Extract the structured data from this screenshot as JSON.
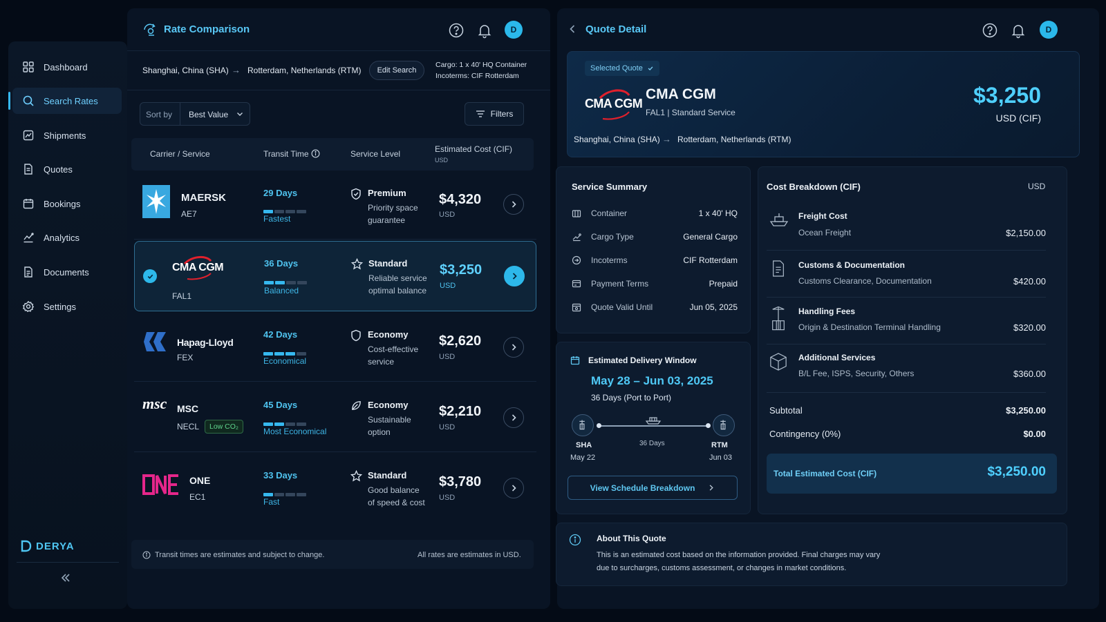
{
  "sidebar": {
    "items": [
      {
        "label": "Dashboard",
        "icon": "grid-icon"
      },
      {
        "label": "Search Rates",
        "icon": "search-icon",
        "active": true
      },
      {
        "label": "Shipments",
        "icon": "shipments-icon"
      },
      {
        "label": "Quotes",
        "icon": "document-icon"
      },
      {
        "label": "Bookings",
        "icon": "calendar-icon"
      },
      {
        "label": "Analytics",
        "icon": "analytics-icon"
      },
      {
        "label": "Documents",
        "icon": "documents-icon"
      },
      {
        "label": "Settings",
        "icon": "gear-icon"
      }
    ],
    "brand": "DERYA"
  },
  "left": {
    "title": "Rate Comparison",
    "avatar": "D",
    "route": {
      "origin": "Shanghai, China (SHA)",
      "destination": "Rotterdam, Netherlands (RTM)",
      "edit_label": "Edit Search",
      "cargo": "Cargo: 1 x 40' HQ Container",
      "incoterms": "Incoterms: CIF Rotterdam"
    },
    "sort": {
      "label": "Sort by",
      "value": "Best Value"
    },
    "filters_label": "Filters",
    "columns": {
      "carrier": "Carrier / Service",
      "transit": "Transit Time",
      "service": "Service Level",
      "cost": "Estimated Cost (CIF)",
      "cost_unit": "USD"
    },
    "rows": [
      {
        "carrier": "MAERSK",
        "code": "AE7",
        "days": "29 Days",
        "tag": "Fastest",
        "level": "Premium",
        "desc1": "Priority space",
        "desc2": "guarantee",
        "price": "$4,320",
        "currency": "USD",
        "speed": 0.25
      },
      {
        "carrier": "CMA CGM",
        "code": "FAL1",
        "days": "36 Days",
        "tag": "Balanced",
        "level": "Standard",
        "desc1": "Reliable service",
        "desc2": "optimal balance",
        "price": "$3,250",
        "currency": "USD",
        "speed": 0.5
      },
      {
        "carrier": "Hapag-Lloyd",
        "code": "FEX",
        "days": "42 Days",
        "tag": "Economical",
        "level": "Economy",
        "desc1": "Cost-effective",
        "desc2": "service",
        "price": "$2,620",
        "currency": "USD",
        "speed": 0.75
      },
      {
        "carrier": "MSC",
        "code": "NECL",
        "badge": "Low CO₂",
        "days": "45 Days",
        "tag": "Most Economical",
        "level": "Economy",
        "desc1": "Sustainable",
        "desc2": "option",
        "price": "$2,210",
        "currency": "USD",
        "speed": 0.5
      },
      {
        "carrier": "ONE",
        "code": "EC1",
        "days": "33 Days",
        "tag": "Fast",
        "level": "Standard",
        "desc1": "Good balance",
        "desc2": "of speed & cost",
        "price": "$3,780",
        "currency": "USD",
        "speed": 0.25
      }
    ],
    "footer_left": "Transit times are estimates and subject to change.",
    "footer_right": "All rates are estimates in USD."
  },
  "right": {
    "title": "Quote Detail",
    "avatar": "D",
    "selected_label": "Selected Quote",
    "carrier": "CMA CGM",
    "logo_text": "CMA CGM",
    "service": "FAL1 | Standard Service",
    "price": "$3,250",
    "price_unit": "USD (CIF)",
    "origin": "Shanghai, China (SHA)",
    "destination": "Rotterdam, Netherlands (RTM)",
    "summary": {
      "title": "Service Summary",
      "items": [
        {
          "label": "Container",
          "value": "1 x 40' HQ"
        },
        {
          "label": "Cargo Type",
          "value": "General Cargo"
        },
        {
          "label": "Incoterms",
          "value": "CIF Rotterdam"
        },
        {
          "label": "Payment Terms",
          "value": "Prepaid"
        },
        {
          "label": "Quote Valid Until",
          "value": "Jun 05, 2025"
        }
      ]
    },
    "delivery": {
      "title": "Estimated Delivery Window",
      "range": "May 28 – Jun 03, 2025",
      "duration": "36 Days (Port to Port)",
      "from_code": "SHA",
      "from_date": "May 22",
      "to_code": "RTM",
      "to_date": "Jun 03",
      "mid": "36 Days",
      "button": "View Schedule Breakdown"
    },
    "breakdown": {
      "title": "Cost Breakdown (CIF)",
      "unit": "USD",
      "items": [
        {
          "title": "Freight Cost",
          "sub": "Ocean Freight",
          "amount": "$2,150.00"
        },
        {
          "title": "Customs & Documentation",
          "sub": "Customs Clearance, Documentation",
          "amount": "$420.00"
        },
        {
          "title": "Handling Fees",
          "sub": "Origin & Destination Terminal Handling",
          "amount": "$320.00"
        },
        {
          "title": "Additional Services",
          "sub": "B/L Fee, ISPS, Security, Others",
          "amount": "$360.00"
        }
      ],
      "subtotal_label": "Subtotal",
      "subtotal": "$3,250.00",
      "contingency_label": "Contingency (0%)",
      "contingency": "$0.00",
      "total_label": "Total Estimated Cost (CIF)",
      "total": "$3,250.00"
    },
    "about": {
      "title": "About This Quote",
      "line1": "This is an estimated cost based on the information provided. Final charges may vary",
      "line2": "due to surcharges, customs assessment, or changes in market conditions."
    }
  }
}
